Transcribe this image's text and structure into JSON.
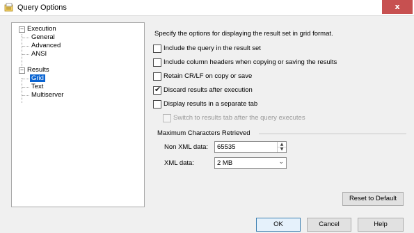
{
  "window": {
    "title": "Query Options",
    "close_label": "x"
  },
  "tree": {
    "execution": {
      "label": "Execution",
      "toggle": "−",
      "children": [
        "General",
        "Advanced",
        "ANSI"
      ]
    },
    "results": {
      "label": "Results",
      "toggle": "−",
      "children": [
        "Grid",
        "Text",
        "Multiserver"
      ]
    },
    "selected": "Grid"
  },
  "panel": {
    "description": "Specify the options for displaying the result set in grid format.",
    "options": [
      {
        "label": "Include the query in the result set",
        "checked": false,
        "enabled": true
      },
      {
        "label": "Include column headers when copying or saving the results",
        "checked": false,
        "enabled": true
      },
      {
        "label": "Retain CR/LF on copy or save",
        "checked": false,
        "enabled": true
      },
      {
        "label": "Discard results after execution",
        "checked": true,
        "enabled": true
      },
      {
        "label": "Display results in a separate tab",
        "checked": false,
        "enabled": true
      },
      {
        "label": "Switch to results tab after the query executes",
        "checked": false,
        "enabled": false
      }
    ],
    "max_chars": {
      "group_label": "Maximum Characters Retrieved",
      "non_xml_label": "Non XML data:",
      "non_xml_value": "65535",
      "xml_label": "XML data:",
      "xml_value": "2 MB"
    },
    "reset_label": "Reset to Default"
  },
  "buttons": {
    "ok": "OK",
    "cancel": "Cancel",
    "help": "Help"
  },
  "colors": {
    "close": "#c75050",
    "selection": "#0a64d2",
    "accent": "#3c7fb1"
  },
  "icons": {
    "title": "query-options-icon",
    "check": "check-icon",
    "spin_up": "chevron-up-icon",
    "spin_down": "chevron-down-icon",
    "dropdown": "chevron-down-icon"
  }
}
